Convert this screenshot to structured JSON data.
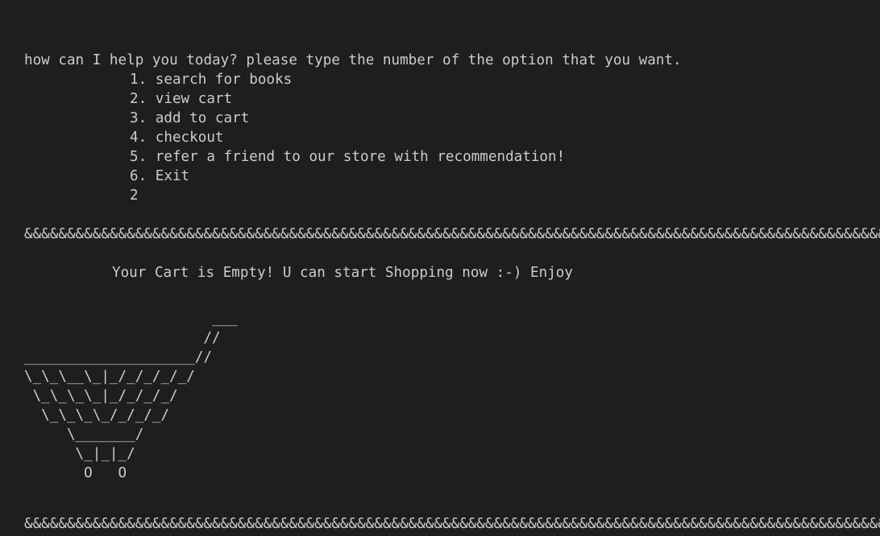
{
  "terminal": {
    "prompt": "how can I help you today? please type the number of the option that you want.",
    "menu": [
      "1. search for books",
      "2. view cart",
      "3. add to cart",
      "4. checkout",
      "5. refer a friend to our store with recommendation!",
      "6. Exit"
    ],
    "user_input": "2",
    "divider_top": "&&&&&&&&&&&&&&&&&&&&&&&&&&&&&&&&&&&&&&&&&&&&&&&&&&&&&&&&&&&&&&&&&&&&&&&&&&&&&&&&&&&&&&&&&&&&&&&&&&&&&&",
    "cart_message": "Your Cart is Empty! U can start Shopping now :-) Enjoy",
    "cart_art": "                      ___\n                     //\n____________________//\n\\_\\_\\__\\_|_/_/_/_/_/\n \\_\\_\\_\\_|_/_/_/_/\n  \\_\\_\\_\\_/_/_/_/\n     \\_______/\n      \\_|_|_/\n       O   O",
    "divider_bottom": "&&&&&&&&&&&&&&&&&&&&&&&&&&&&&&&&&&&&&&&&&&&&&&&&&&&&&&&&&&&&&&&&&&&&&&&&&&&&&&&&&&&&&&&&&&&&&&&&&&&&&&"
  },
  "colors": {
    "background": "#1e1e1e",
    "foreground": "#cccccc"
  }
}
